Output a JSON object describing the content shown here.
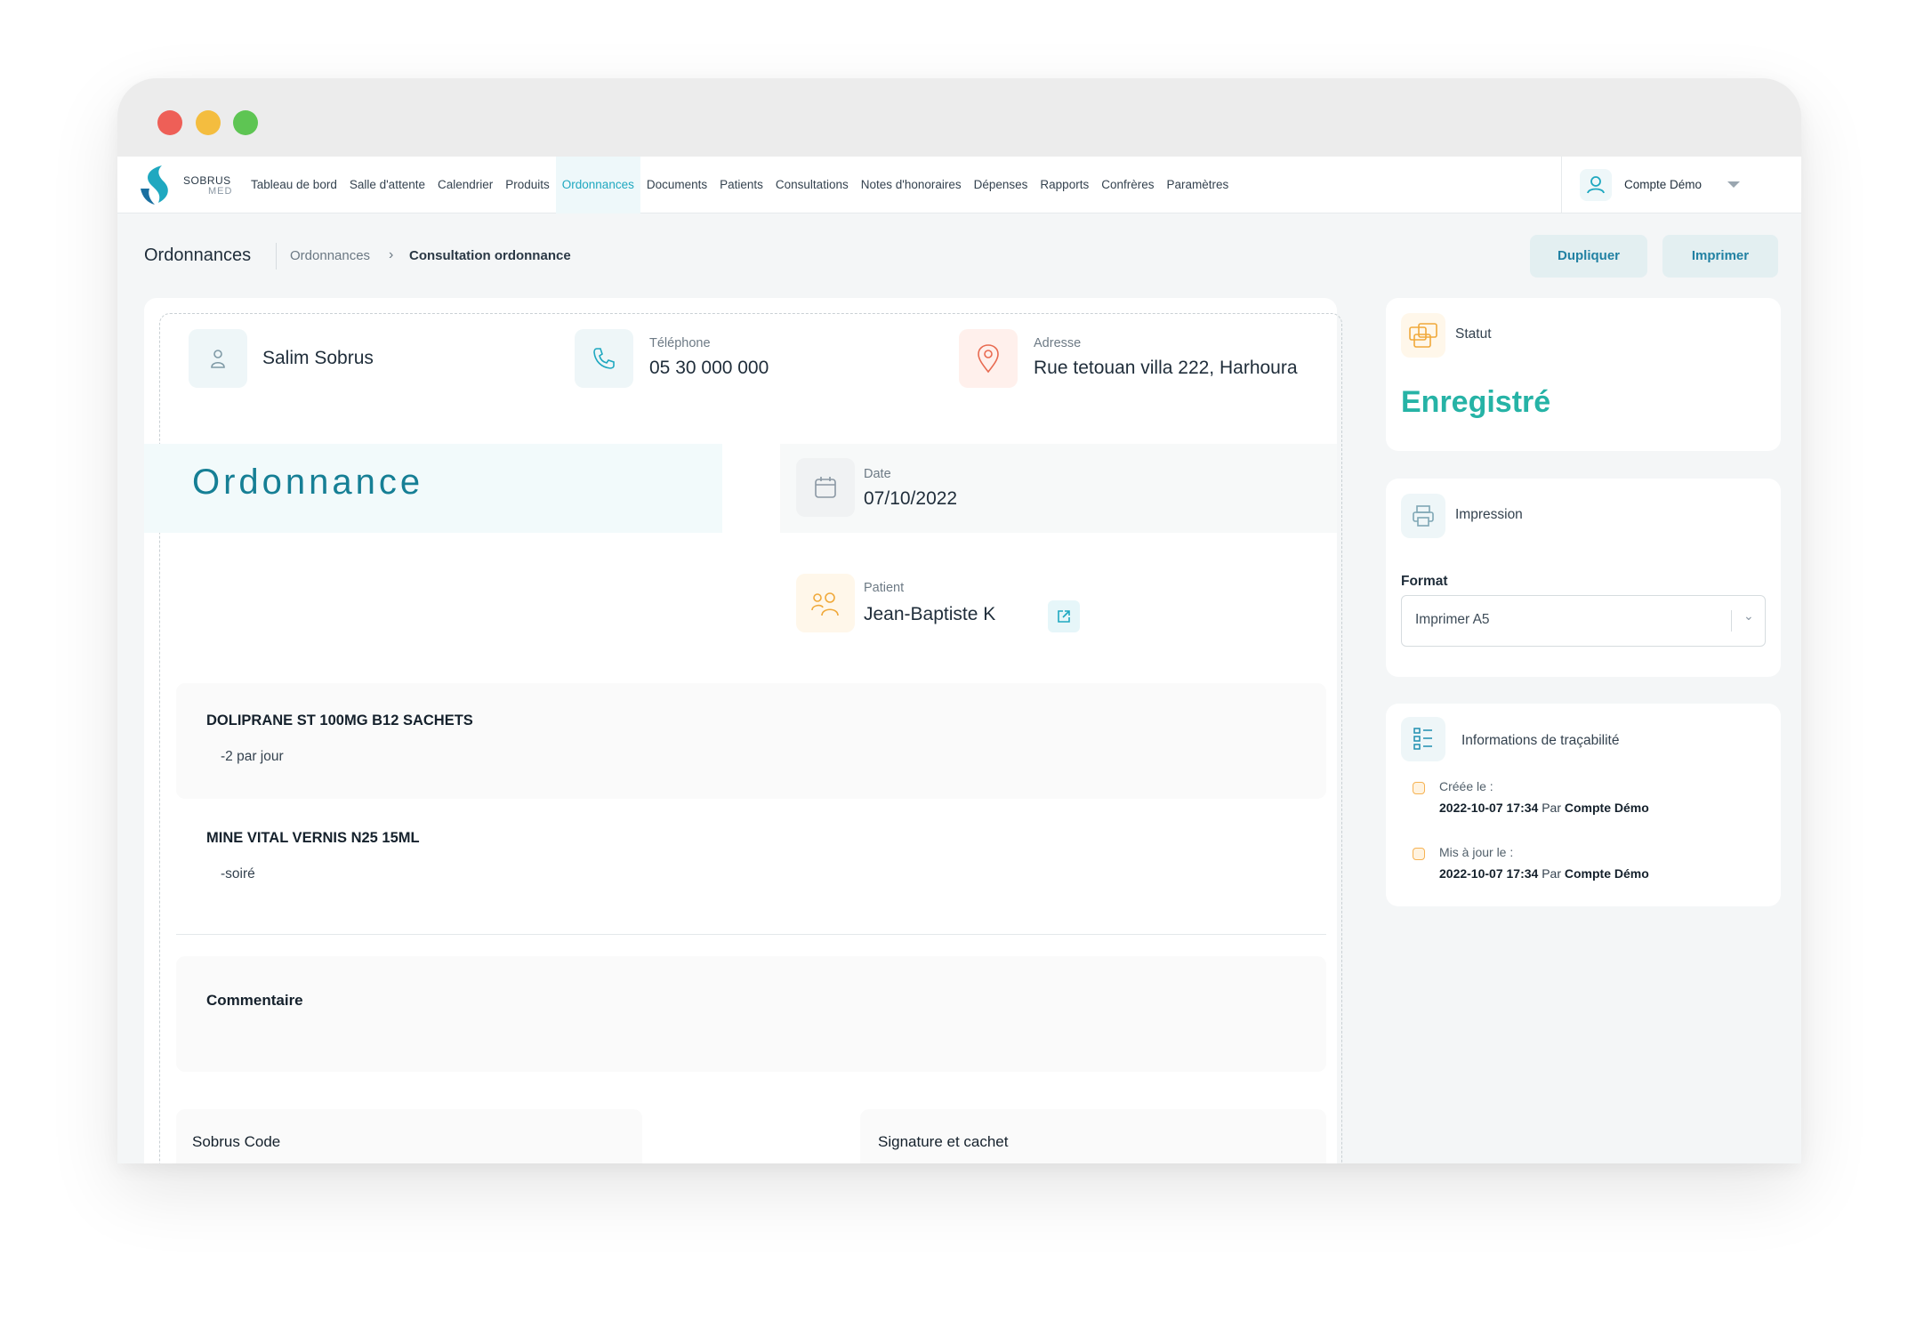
{
  "brand": {
    "name_top": "SOBRUS",
    "name_bottom": "MED"
  },
  "nav": {
    "items": [
      {
        "label": "Tableau de bord"
      },
      {
        "label": "Salle d'attente"
      },
      {
        "label": "Calendrier"
      },
      {
        "label": "Produits"
      },
      {
        "label": "Ordonnances",
        "active": true
      },
      {
        "label": "Documents"
      },
      {
        "label": "Patients"
      },
      {
        "label": "Consultations"
      },
      {
        "label": "Notes d'honoraires"
      },
      {
        "label": "Dépenses"
      },
      {
        "label": "Rapports"
      },
      {
        "label": "Confrères"
      },
      {
        "label": "Paramètres"
      }
    ],
    "account_name": "Compte Démo"
  },
  "header": {
    "title": "Ordonnances",
    "breadcrumb": [
      "Ordonnances",
      "Consultation ordonnance"
    ],
    "buttons": {
      "duplicate": "Dupliquer",
      "print": "Imprimer"
    }
  },
  "doctor": {
    "name": "Salim Sobrus",
    "phone_label": "Téléphone",
    "phone": "05 30 000 000",
    "address_label": "Adresse",
    "address": "Rue tetouan villa 222, Harhoura"
  },
  "prescription": {
    "title": "Ordonnance",
    "date_label": "Date",
    "date": "07/10/2022",
    "patient_label": "Patient",
    "patient": "Jean-Baptiste K",
    "medications": [
      {
        "name": "DOLIPRANE ST 100MG B12 SACHETS",
        "dose": "-2 par jour"
      },
      {
        "name": "MINE VITAL VERNIS N25 15ML",
        "dose": "-soiré"
      }
    ],
    "comment_label": "Commentaire",
    "footer": {
      "code_label": "Sobrus Code",
      "signature_label": "Signature et cachet"
    }
  },
  "status": {
    "title": "Statut",
    "value": "Enregistré"
  },
  "printing": {
    "title": "Impression",
    "format_label": "Format",
    "format_value": "Imprimer A5"
  },
  "traceability": {
    "title": "Informations de traçabilité",
    "created_label": "Créée le :",
    "created_date": "2022-10-07 17:34",
    "created_by_prefix": "Par",
    "created_by": "Compte Démo",
    "updated_label": "Mis à jour le :",
    "updated_date": "2022-10-07 17:34",
    "updated_by_prefix": "Par",
    "updated_by": "Compte Démo"
  },
  "colors": {
    "accent": "#1fa8c0",
    "status": "#26b3a6",
    "title_teal": "#167f95",
    "button_bg": "#e3eff1"
  }
}
